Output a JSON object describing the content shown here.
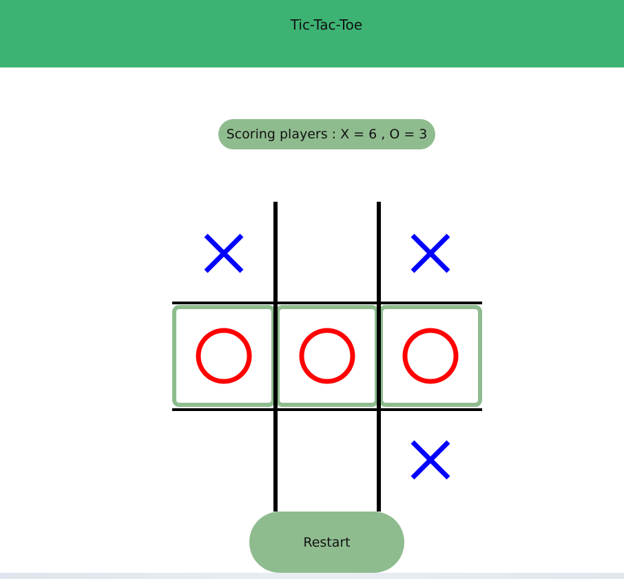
{
  "header": {
    "title": "Tic-Tac-Toe",
    "color": "#3db373"
  },
  "score": {
    "label": "Scoring players : X = 6 , O = 3",
    "x": 6,
    "o": 3
  },
  "board": {
    "cells": [
      "X",
      "",
      "X",
      "O",
      "O",
      "O",
      "",
      "",
      "X"
    ],
    "winning_cells": [
      3,
      4,
      5
    ],
    "x_color": "#0000ff",
    "o_color": "#ff0000",
    "highlight_color": "#8fbc8f"
  },
  "controls": {
    "restart_label": "Restart"
  }
}
